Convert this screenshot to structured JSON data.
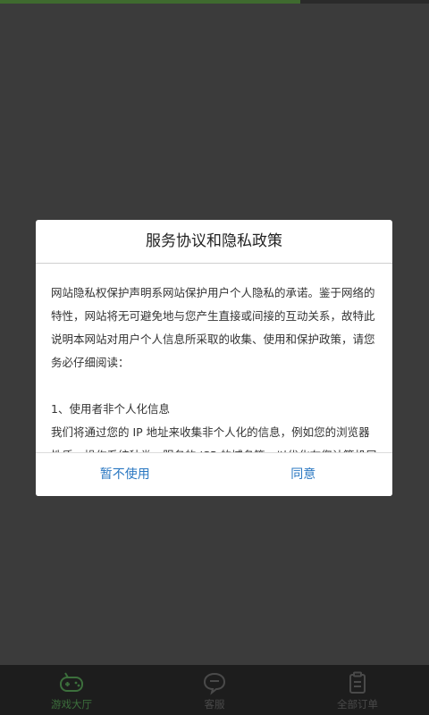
{
  "loading": {
    "progress_percent": 70
  },
  "dialog": {
    "title": "服务协议和隐私政策",
    "paragraphs": [
      "网站隐私权保护声明系网站保护用户个人隐私的承诺。鉴于网络的特性，网站将无可避免地与您产生直接或间接的互动关系，故特此说明本网站对用户个人信息所采取的收集、使用和保护政策，请您务必仔细阅读：",
      "1、使用者非个人化信息",
      "我们将通过您的 IP 地址来收集非个人化的信息，例如您的浏览器性质、操作系统种类、服务的 ISP 的域名等，以优化在您计算机屏幕上显示的页面。"
    ],
    "decline_label": "暂不使用",
    "agree_label": "同意"
  },
  "tabbar": {
    "items": [
      {
        "label": "游戏大厅",
        "icon": "gamepad-icon",
        "color": "#3c6f3c"
      },
      {
        "label": "客服",
        "icon": "chat-icon",
        "color": "#4a4a4a"
      },
      {
        "label": "全部订单",
        "icon": "clipboard-icon",
        "color": "#4a4a4a"
      }
    ]
  }
}
